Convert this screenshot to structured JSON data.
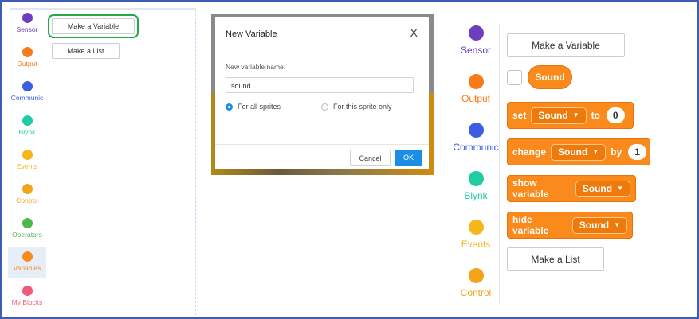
{
  "left_panel": {
    "categories": [
      {
        "label": "Sensor",
        "color": "#6d3fc0"
      },
      {
        "label": "Output",
        "color": "#f77b1a"
      },
      {
        "label": "Communic",
        "color": "#3d5de3"
      },
      {
        "label": "Blynk",
        "color": "#1fcda0"
      },
      {
        "label": "Events",
        "color": "#f4b61a"
      },
      {
        "label": "Control",
        "color": "#f6a31c"
      },
      {
        "label": "Operators",
        "color": "#4cb848"
      },
      {
        "label": "Variables",
        "color": "#f98a1b"
      },
      {
        "label": "My Blocks",
        "color": "#f05a78"
      }
    ],
    "make_variable_label": "Make a Variable",
    "make_list_label": "Make a List"
  },
  "dialog": {
    "title": "New Variable",
    "close_symbol": "X",
    "field_label": "New variable name:",
    "field_value": "sound",
    "option_all": "For all sprites",
    "option_this": "For this sprite only",
    "selected_option": "For all sprites",
    "cancel_label": "Cancel",
    "ok_label": "OK"
  },
  "right_panel": {
    "categories": [
      {
        "label": "Sensor",
        "color": "#6d3fc0"
      },
      {
        "label": "Output",
        "color": "#f77b1a"
      },
      {
        "label": "Communic",
        "color": "#3d5de3"
      },
      {
        "label": "Blynk",
        "color": "#1fcda0"
      },
      {
        "label": "Events",
        "color": "#f4b61a"
      },
      {
        "label": "Control",
        "color": "#f6a31c"
      }
    ],
    "make_variable_label": "Make a Variable",
    "variable_name": "Sound",
    "set_block": {
      "word": "set",
      "var": "Sound",
      "to": "to",
      "value": "0"
    },
    "change_block": {
      "word": "change",
      "var": "Sound",
      "by": "by",
      "value": "1"
    },
    "show_block": {
      "word": "show variable",
      "var": "Sound"
    },
    "hide_block": {
      "word": "hide variable",
      "var": "Sound"
    },
    "make_list_label": "Make a List",
    "dropdown_glyph": "▼"
  }
}
